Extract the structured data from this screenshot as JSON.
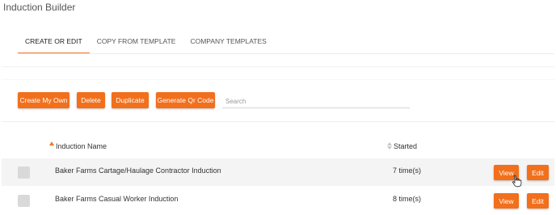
{
  "page": {
    "title": "Induction Builder"
  },
  "tabs": [
    {
      "label": "CREATE OR EDIT",
      "active": true
    },
    {
      "label": "COPY FROM TEMPLATE",
      "active": false
    },
    {
      "label": "COMPANY TEMPLATES",
      "active": false
    }
  ],
  "toolbar": {
    "create_label": "Create My Own",
    "delete_label": "Delete",
    "duplicate_label": "Duplicate",
    "qr_label": "Generate Qr Code",
    "search_placeholder": "Search",
    "search_value": ""
  },
  "table": {
    "columns": [
      {
        "label": "Induction Name",
        "sort": "ascending"
      },
      {
        "label": "Started",
        "sort": "none"
      }
    ],
    "rows": [
      {
        "name": "Baker Farms Cartage/Haulage Contractor Induction",
        "started": "7 time(s)",
        "view_label": "View",
        "edit_label": "Edit"
      },
      {
        "name": "Baker Farms Casual Worker Induction",
        "started": "8 time(s)",
        "view_label": "View",
        "edit_label": "Edit"
      }
    ]
  },
  "colors": {
    "accent": "#f26f1c",
    "tab_underline": "#f0772a",
    "row_highlight": "#f4f4f4"
  },
  "icons": {
    "sort_asc": "sort-ascending-icon",
    "sort_both": "sort-icon",
    "checkbox": "checkbox",
    "cursor": "hand-pointer-cursor"
  }
}
